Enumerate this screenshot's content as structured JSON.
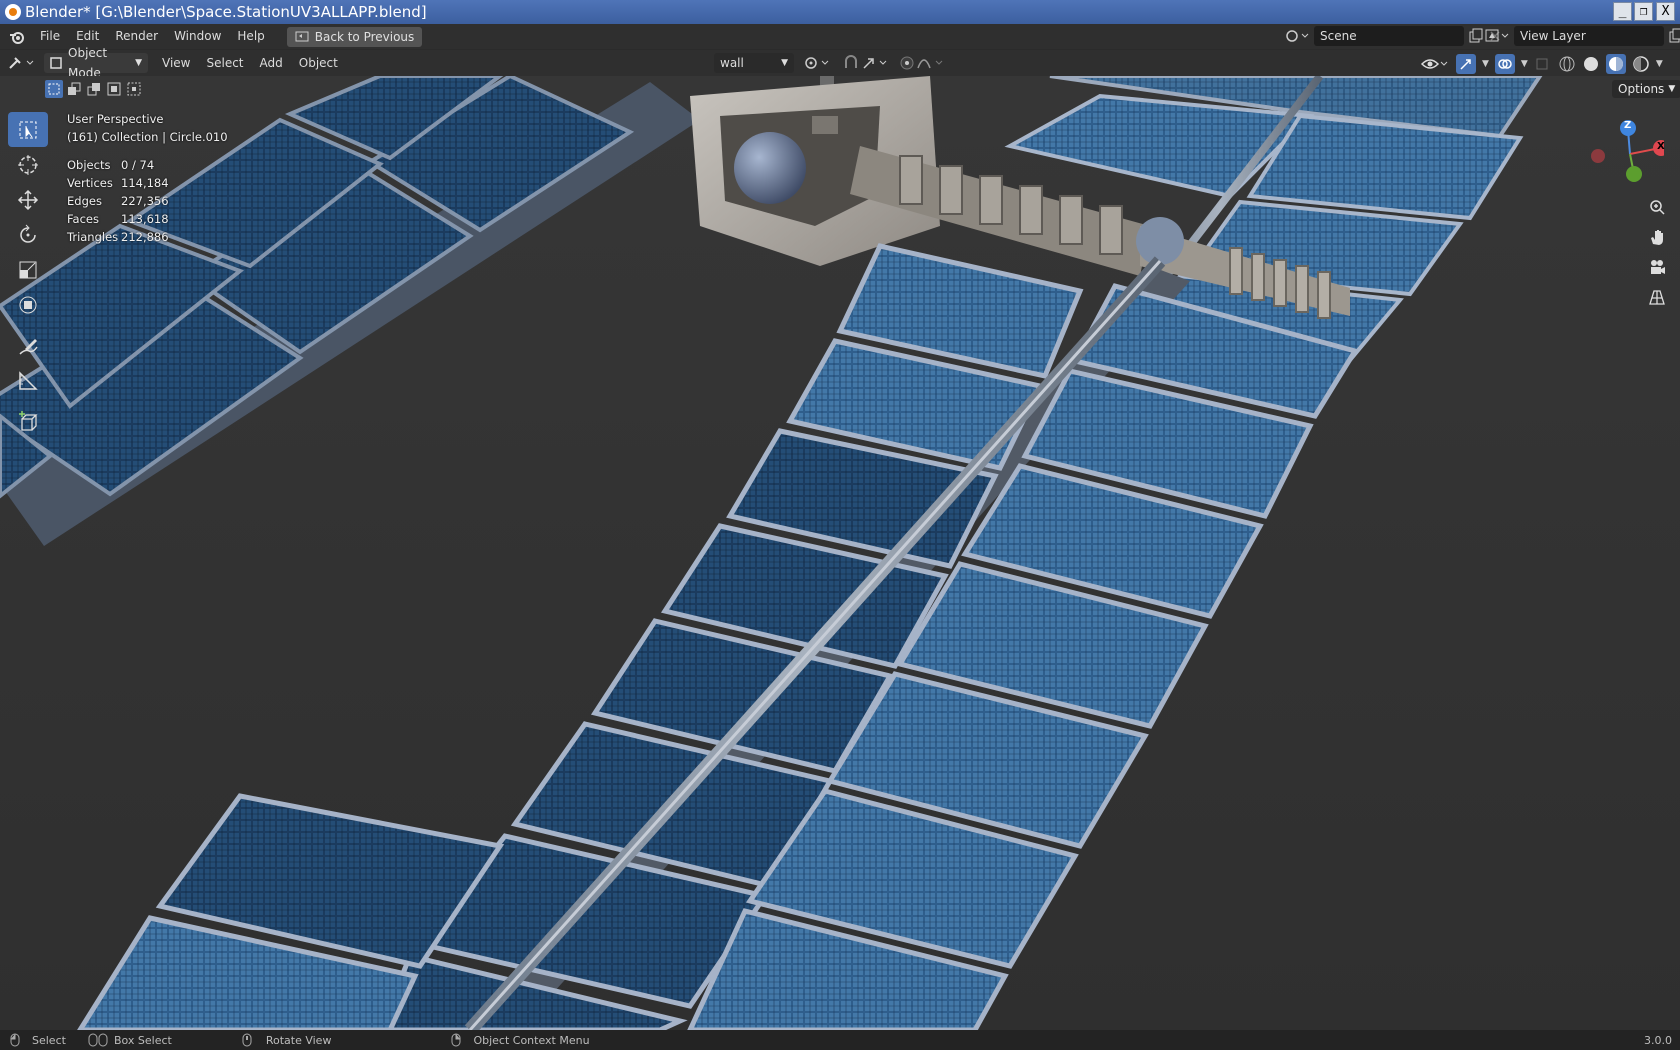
{
  "window": {
    "title": "Blender* [G:\\Blender\\Space.StationUV3ALLAPP.blend]",
    "minimize": "_",
    "restore": "❐",
    "close": "X"
  },
  "menu": {
    "items": [
      "File",
      "Edit",
      "Render",
      "Window",
      "Help"
    ],
    "back_button": "Back to Previous",
    "scene": "Scene",
    "view_layer": "View Layer"
  },
  "header": {
    "mode": "Object Mode",
    "menus": [
      "View",
      "Select",
      "Add",
      "Object"
    ],
    "orientation": "wall",
    "options": "Options"
  },
  "overlay": {
    "perspective": "User Perspective",
    "collection": "(161) Collection | Circle.010",
    "stats": [
      {
        "label": "Objects",
        "value": "0 / 74"
      },
      {
        "label": "Vertices",
        "value": "114,184"
      },
      {
        "label": "Edges",
        "value": "227,356"
      },
      {
        "label": "Faces",
        "value": "113,618"
      },
      {
        "label": "Triangles",
        "value": "212,886"
      }
    ]
  },
  "gizmo": {
    "z": "Z",
    "x": "X"
  },
  "status": {
    "select": "Select",
    "box_select": "Box Select",
    "rotate": "Rotate View",
    "context": "Object Context Menu",
    "version": "3.0.0"
  },
  "colors": {
    "accent": "#4772b3",
    "title_bar": "#4a6fb0",
    "panel": "#0f2d52",
    "panel_light": "#3d6d9c",
    "frame": "#8a9bb6"
  }
}
